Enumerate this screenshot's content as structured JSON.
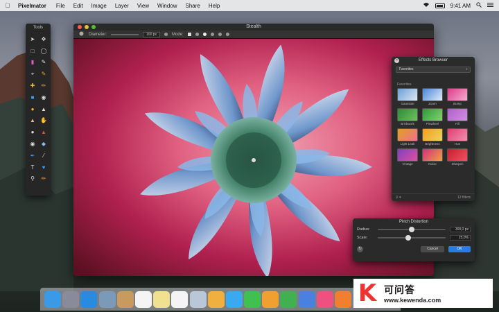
{
  "menubar": {
    "app_name": "Pixelmator",
    "items": [
      "File",
      "Edit",
      "Image",
      "Layer",
      "View",
      "Window",
      "Share",
      "Help"
    ],
    "time": "9:41 AM",
    "icons": [
      "apple-icon",
      "wifi-icon",
      "battery-icon",
      "spotlight-icon",
      "notification-list-icon"
    ]
  },
  "window": {
    "title": "Stealth",
    "options": {
      "diameter_label": "Diameter:",
      "diameter_value": "100 px",
      "mode_label": "Mode:"
    }
  },
  "tools": {
    "title": "Tools",
    "icons": [
      "arrow-icon",
      "move-icon",
      "rect-select-icon",
      "ellipse-select-icon",
      "eraser-icon",
      "color-picker-icon",
      "crop-icon",
      "brush-icon",
      "healing-icon",
      "pencil-icon",
      "paint-bucket-icon",
      "retouch-icon",
      "speech-bubble-icon",
      "sharpen-icon",
      "stamp-icon",
      "smudge-icon",
      "dodge-icon",
      "burn-icon",
      "eye-icon",
      "water-drop-icon",
      "pen-icon",
      "line-icon",
      "type-icon",
      "heart-icon",
      "zoom-icon",
      "eyedropper-icon"
    ]
  },
  "effects_browser": {
    "title": "Effects Browser",
    "selected_category": "Favorites",
    "section_label": "Favorites",
    "items": [
      {
        "label": "Gaussian",
        "color_a": "#6a9fd4",
        "color_b": "#dfe8f4"
      },
      {
        "label": "Zoom",
        "color_a": "#4a86d8",
        "color_b": "#e0ecf8"
      },
      {
        "label": "Bump",
        "color_a": "#e03a8a",
        "color_b": "#f4b0d0"
      },
      {
        "label": "Brickwork",
        "color_a": "#2e8a3a",
        "color_b": "#72c060"
      },
      {
        "label": "Pinwheel",
        "color_a": "#2a9a3e",
        "color_b": "#8ad070"
      },
      {
        "label": "Fill",
        "color_a": "#b060c8",
        "color_b": "#d090e0"
      },
      {
        "label": "Light Leak",
        "color_a": "#e0a020",
        "color_b": "#f07090"
      },
      {
        "label": "Brightness",
        "color_a": "#f0a020",
        "color_b": "#f0d060"
      },
      {
        "label": "Hue",
        "color_a": "#e04070",
        "color_b": "#f090b0"
      },
      {
        "label": "Vintage",
        "color_a": "#8040c0",
        "color_b": "#e050a0"
      },
      {
        "label": "Noise",
        "color_a": "#d03080",
        "color_b": "#f0a040"
      },
      {
        "label": "Sharpen",
        "color_a": "#c82030",
        "color_b": "#f05060"
      }
    ],
    "footer_count": "12 filters"
  },
  "pinch_distortion": {
    "title": "Pinch Distortion",
    "radius_label": "Radius:",
    "radius_value": "300,0 px",
    "radius_level": 0.5,
    "scale_label": "Scale:",
    "scale_value": "25,0%",
    "scale_level": 0.45,
    "cancel_label": "Cancel",
    "ok_label": "OK"
  },
  "dock": {
    "icons": [
      {
        "name": "finder-icon",
        "color": "#3a9ae8"
      },
      {
        "name": "launchpad-icon",
        "color": "#8a8a9a"
      },
      {
        "name": "safari-icon",
        "color": "#2a8ae0"
      },
      {
        "name": "photo-icon",
        "color": "#7a9ab8"
      },
      {
        "name": "contacts-icon",
        "color": "#c89a60"
      },
      {
        "name": "calendar-icon",
        "color": "#f4f4f4"
      },
      {
        "name": "notes-icon",
        "color": "#f0e090"
      },
      {
        "name": "reminders-icon",
        "color": "#f4f4f4"
      },
      {
        "name": "preview-icon",
        "color": "#b8c8d8"
      },
      {
        "name": "photos-icon",
        "color": "#f0b040"
      },
      {
        "name": "messages-icon",
        "color": "#3aaaf0"
      },
      {
        "name": "facetime-icon",
        "color": "#40c050"
      },
      {
        "name": "pages-icon",
        "color": "#f0a030"
      },
      {
        "name": "numbers-icon",
        "color": "#40b050"
      },
      {
        "name": "keynote-icon",
        "color": "#4a80e0"
      },
      {
        "name": "itunes-icon",
        "color": "#f05080"
      },
      {
        "name": "ibooks-icon",
        "color": "#f08030"
      },
      {
        "name": "appstore-icon",
        "color": "#3a8ae8"
      }
    ]
  },
  "watermark": {
    "logo": "K",
    "name": "可问答",
    "url": "www.kewenda.com"
  }
}
